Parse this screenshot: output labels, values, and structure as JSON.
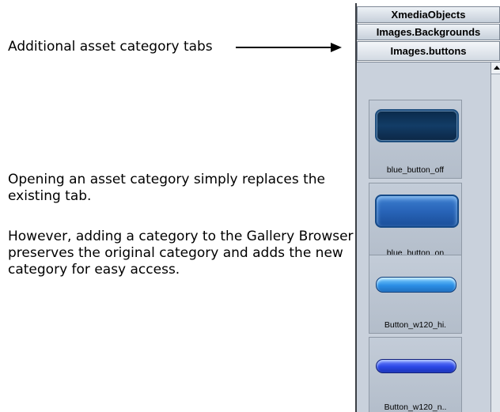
{
  "callouts": {
    "tabs": "Additional asset category tabs",
    "opening": "Opening an asset category simply replaces the existing tab.",
    "adding": "However, adding a category to the Gallery Browser preserves the original category and adds the new category for easy access."
  },
  "gallery": {
    "tabs": [
      {
        "label": "XmediaObjects"
      },
      {
        "label": "Images.Backgrounds"
      },
      {
        "label": "Images.buttons"
      }
    ],
    "items": [
      {
        "label": "blue_button_off"
      },
      {
        "label": "blue_button_on"
      },
      {
        "label": "Button_w120_hi."
      },
      {
        "label": "Button_w120_n.."
      }
    ]
  },
  "colors": {
    "panel": "#c9d1dc",
    "tab": "#c6cfda",
    "border": "#7d8794"
  }
}
